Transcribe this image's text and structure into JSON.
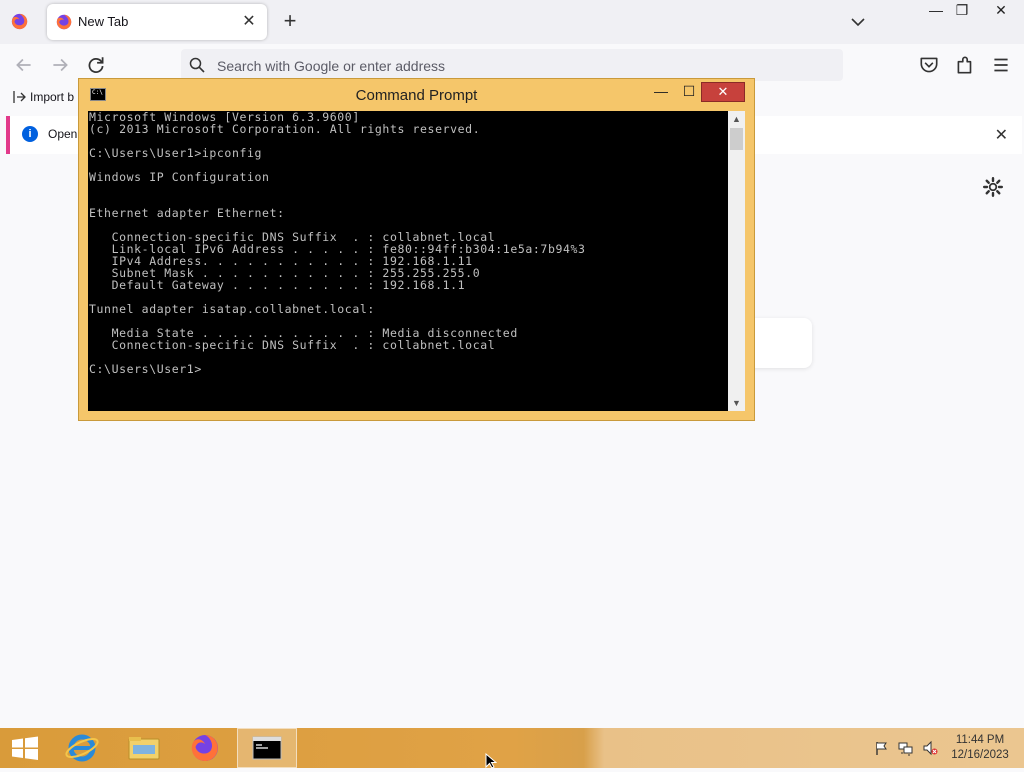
{
  "browser": {
    "tab": {
      "title": "New Tab"
    },
    "urlbar": {
      "placeholder": "Search with Google or enter address"
    },
    "bookmarks": {
      "import_label": "Import b"
    },
    "notice": {
      "text": "Open p"
    }
  },
  "cmd": {
    "title": "Command Prompt",
    "console_lines": [
      "Microsoft Windows [Version 6.3.9600]",
      "(c) 2013 Microsoft Corporation. All rights reserved.",
      "",
      "C:\\Users\\User1>ipconfig",
      "",
      "Windows IP Configuration",
      "",
      "",
      "Ethernet adapter Ethernet:",
      "",
      "   Connection-specific DNS Suffix  . : collabnet.local",
      "   Link-local IPv6 Address . . . . . : fe80::94ff:b304:1e5a:7b94%3",
      "   IPv4 Address. . . . . . . . . . . : 192.168.1.11",
      "   Subnet Mask . . . . . . . . . . . : 255.255.255.0",
      "   Default Gateway . . . . . . . . . : 192.168.1.1",
      "",
      "Tunnel adapter isatap.collabnet.local:",
      "",
      "   Media State . . . . . . . . . . . : Media disconnected",
      "   Connection-specific DNS Suffix  . : collabnet.local",
      "",
      "C:\\Users\\User1>"
    ]
  },
  "taskbar": {
    "clock": {
      "time": "11:44 PM",
      "date": "12/16/2023"
    }
  },
  "colors": {
    "taskbar": "#e0a246",
    "cmd_frame": "#f5c66a",
    "cmd_close": "#c7413c",
    "notice_accent": "#e23a8a"
  }
}
